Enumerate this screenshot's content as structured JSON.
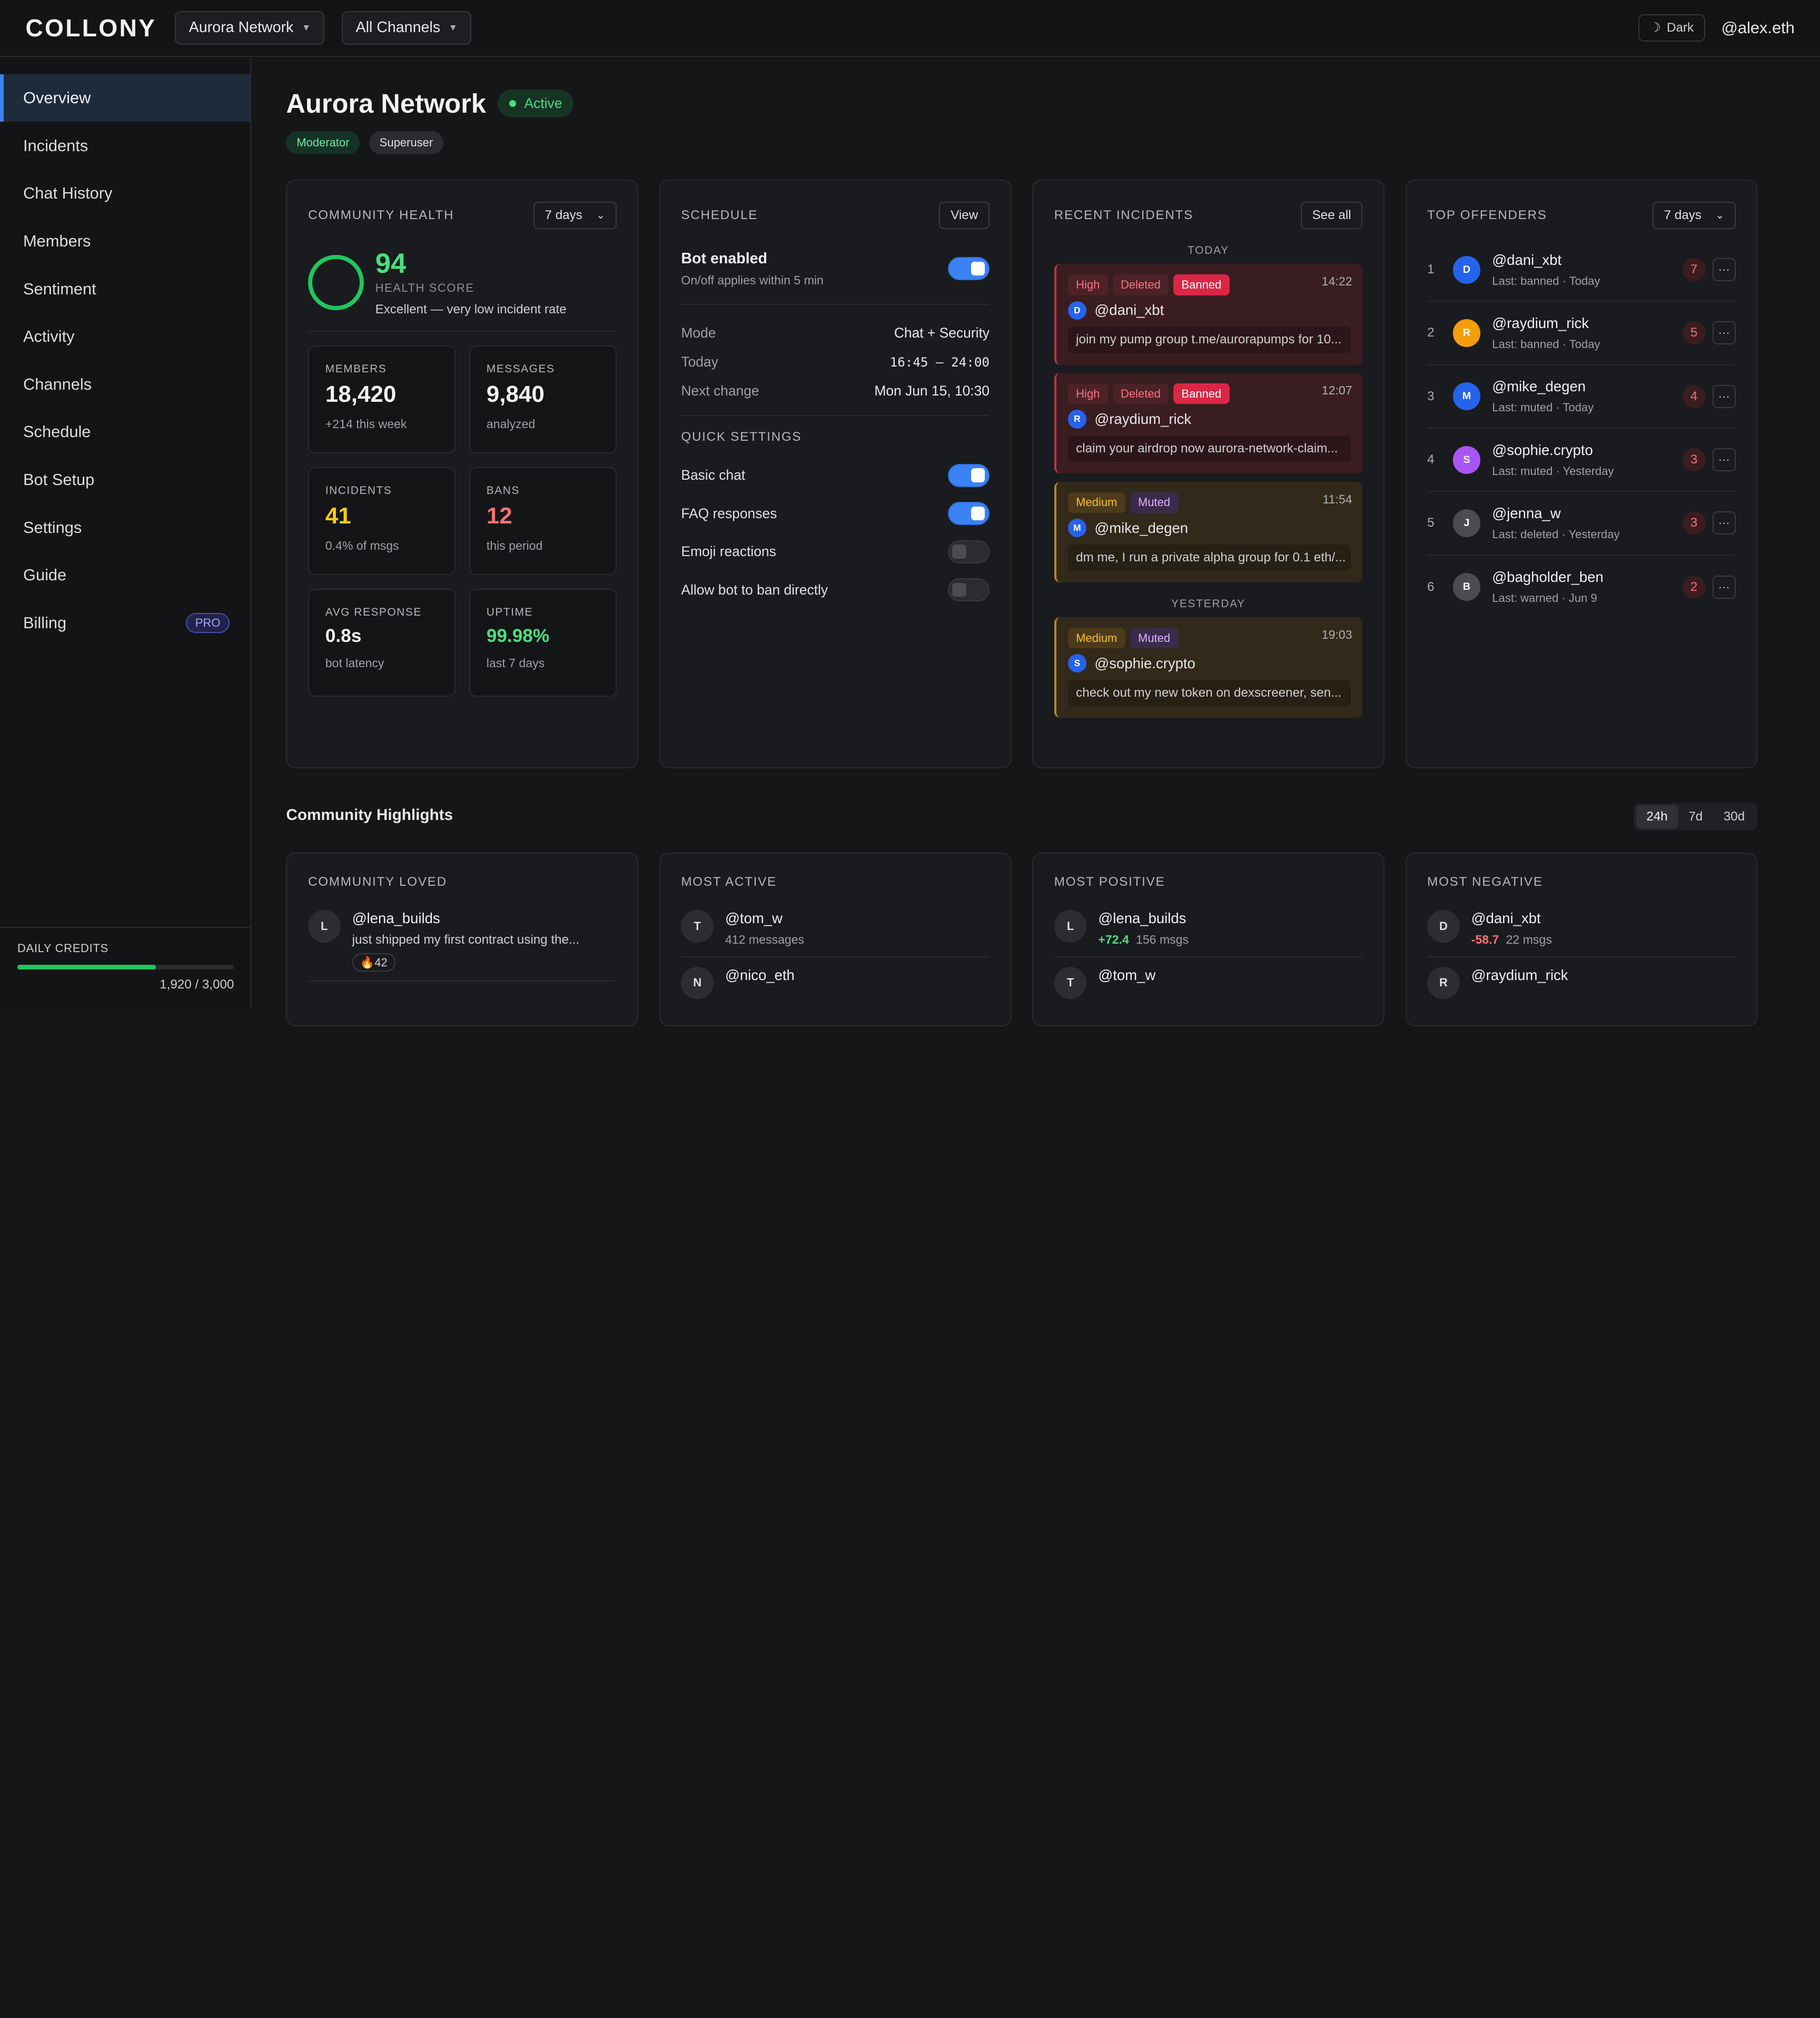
{
  "app": {
    "logo": "COLLONY",
    "workspace": "Aurora Network",
    "channels": "All Channels",
    "theme": "Dark",
    "user": "@alex.eth"
  },
  "nav": [
    {
      "label": "Overview"
    },
    {
      "label": "Incidents"
    },
    {
      "label": "Chat History"
    },
    {
      "label": "Members"
    },
    {
      "label": "Sentiment"
    },
    {
      "label": "Activity"
    },
    {
      "label": "Channels"
    },
    {
      "label": "Schedule"
    },
    {
      "label": "Bot Setup"
    },
    {
      "label": "Settings"
    },
    {
      "label": "Guide"
    },
    {
      "label": "Billing",
      "badge": "PRO"
    }
  ],
  "credits": {
    "label": "DAILY CREDITS",
    "value": "1,920 / 3,000",
    "fraction": 0.64
  },
  "page": {
    "title": "Aurora Network",
    "status": "Active",
    "roles": [
      "Moderator",
      "Superuser"
    ]
  },
  "health": {
    "title": "COMMUNITY HEALTH",
    "range": "7 days",
    "score": "94",
    "score_label": "HEALTH SCORE",
    "desc": "Excellent — very low incident rate",
    "stats": [
      {
        "label": "MEMBERS",
        "value": "18,420",
        "sub": "+214 this week"
      },
      {
        "label": "MESSAGES",
        "value": "9,840",
        "sub": "analyzed"
      },
      {
        "label": "INCIDENTS",
        "value": "41",
        "sub": "0.4% of msgs"
      },
      {
        "label": "BANS",
        "value": "12",
        "sub": "this period"
      },
      {
        "label": "AVG RESPONSE",
        "value": "0.8s",
        "sub": "bot latency"
      },
      {
        "label": "UPTIME",
        "value": "99.98%",
        "sub": "last 7 days"
      }
    ]
  },
  "schedule": {
    "title": "SCHEDULE",
    "view": "View",
    "bot_label": "Bot enabled",
    "bot_sub": "On/off applies within 5 min",
    "bot_on": true,
    "mode_label": "Mode",
    "mode": "Chat + Security",
    "today_label": "Today",
    "today": "16:45 — 24:00",
    "next_label": "Next change",
    "next": "Mon Jun 15, 10:30",
    "qs_title": "QUICK SETTINGS",
    "quick": [
      {
        "label": "Basic chat",
        "on": true
      },
      {
        "label": "FAQ responses",
        "on": true
      },
      {
        "label": "Emoji reactions",
        "on": false
      },
      {
        "label": "Allow bot to ban directly",
        "on": false
      }
    ]
  },
  "incidents": {
    "title": "RECENT INCIDENTS",
    "see_all": "See all",
    "today": "TODAY",
    "yesterday": "YESTERDAY",
    "items": [
      {
        "sev": "High",
        "tags": [
          "Deleted",
          "Banned"
        ],
        "time": "14:22",
        "user": "@dani_xbt",
        "initial": "D",
        "msg": "join my pump group t.me/aurorapumps for 10..."
      },
      {
        "sev": "High",
        "tags": [
          "Deleted",
          "Banned"
        ],
        "time": "12:07",
        "user": "@raydium_rick",
        "initial": "R",
        "msg": "claim your airdrop now aurora-network-claim..."
      },
      {
        "sev": "Medium",
        "tags": [
          "Muted"
        ],
        "time": "11:54",
        "user": "@mike_degen",
        "initial": "M",
        "msg": "dm me, I run a private alpha group for 0.1 eth/..."
      },
      {
        "sev": "Medium",
        "tags": [
          "Muted"
        ],
        "time": "19:03",
        "user": "@sophie.crypto",
        "initial": "S",
        "msg": "check out my new token on dexscreener, sen..."
      }
    ]
  },
  "offenders": {
    "title": "TOP OFFENDERS",
    "range": "7 days",
    "more": "···",
    "items": [
      {
        "rank": "1",
        "name": "@dani_xbt",
        "initial": "D",
        "last": "Last: banned · Today",
        "count": "7",
        "color": "#2563eb"
      },
      {
        "rank": "2",
        "name": "@raydium_rick",
        "initial": "R",
        "last": "Last: banned · Today",
        "count": "5",
        "color": "#f59e0b"
      },
      {
        "rank": "3",
        "name": "@mike_degen",
        "initial": "M",
        "last": "Last: muted · Today",
        "count": "4",
        "color": "#2563eb"
      },
      {
        "rank": "4",
        "name": "@sophie.crypto",
        "initial": "S",
        "last": "Last: muted · Yesterday",
        "count": "3",
        "color": "#a855f7"
      },
      {
        "rank": "5",
        "name": "@jenna_w",
        "initial": "J",
        "last": "Last: deleted · Yesterday",
        "count": "3",
        "color": "#4b4c52"
      },
      {
        "rank": "6",
        "name": "@bagholder_ben",
        "initial": "B",
        "last": "Last: warned · Jun 9",
        "count": "2",
        "color": "#4b4c52"
      }
    ]
  },
  "highlights": {
    "title": "Community Highlights",
    "ranges": [
      "24h",
      "7d",
      "30d"
    ],
    "loved": {
      "title": "COMMUNITY LOVED",
      "name": "@lena_builds",
      "initial": "L",
      "text": "just shipped my first contract using the...",
      "react": "🔥42"
    },
    "active": {
      "title": "MOST ACTIVE",
      "name": "@tom_w",
      "initial": "T",
      "sub": "412 messages",
      "name2": "@nico_eth",
      "initial2": "N"
    },
    "positive": {
      "title": "MOST POSITIVE",
      "name": "@lena_builds",
      "initial": "L",
      "score": "+72.4",
      "sub": "156 msgs",
      "name2": "@tom_w",
      "initial2": "T"
    },
    "negative": {
      "title": "MOST NEGATIVE",
      "name": "@dani_xbt",
      "initial": "D",
      "score": "-58.7",
      "sub": "22 msgs",
      "name2": "@raydium_rick",
      "initial2": "R"
    }
  }
}
